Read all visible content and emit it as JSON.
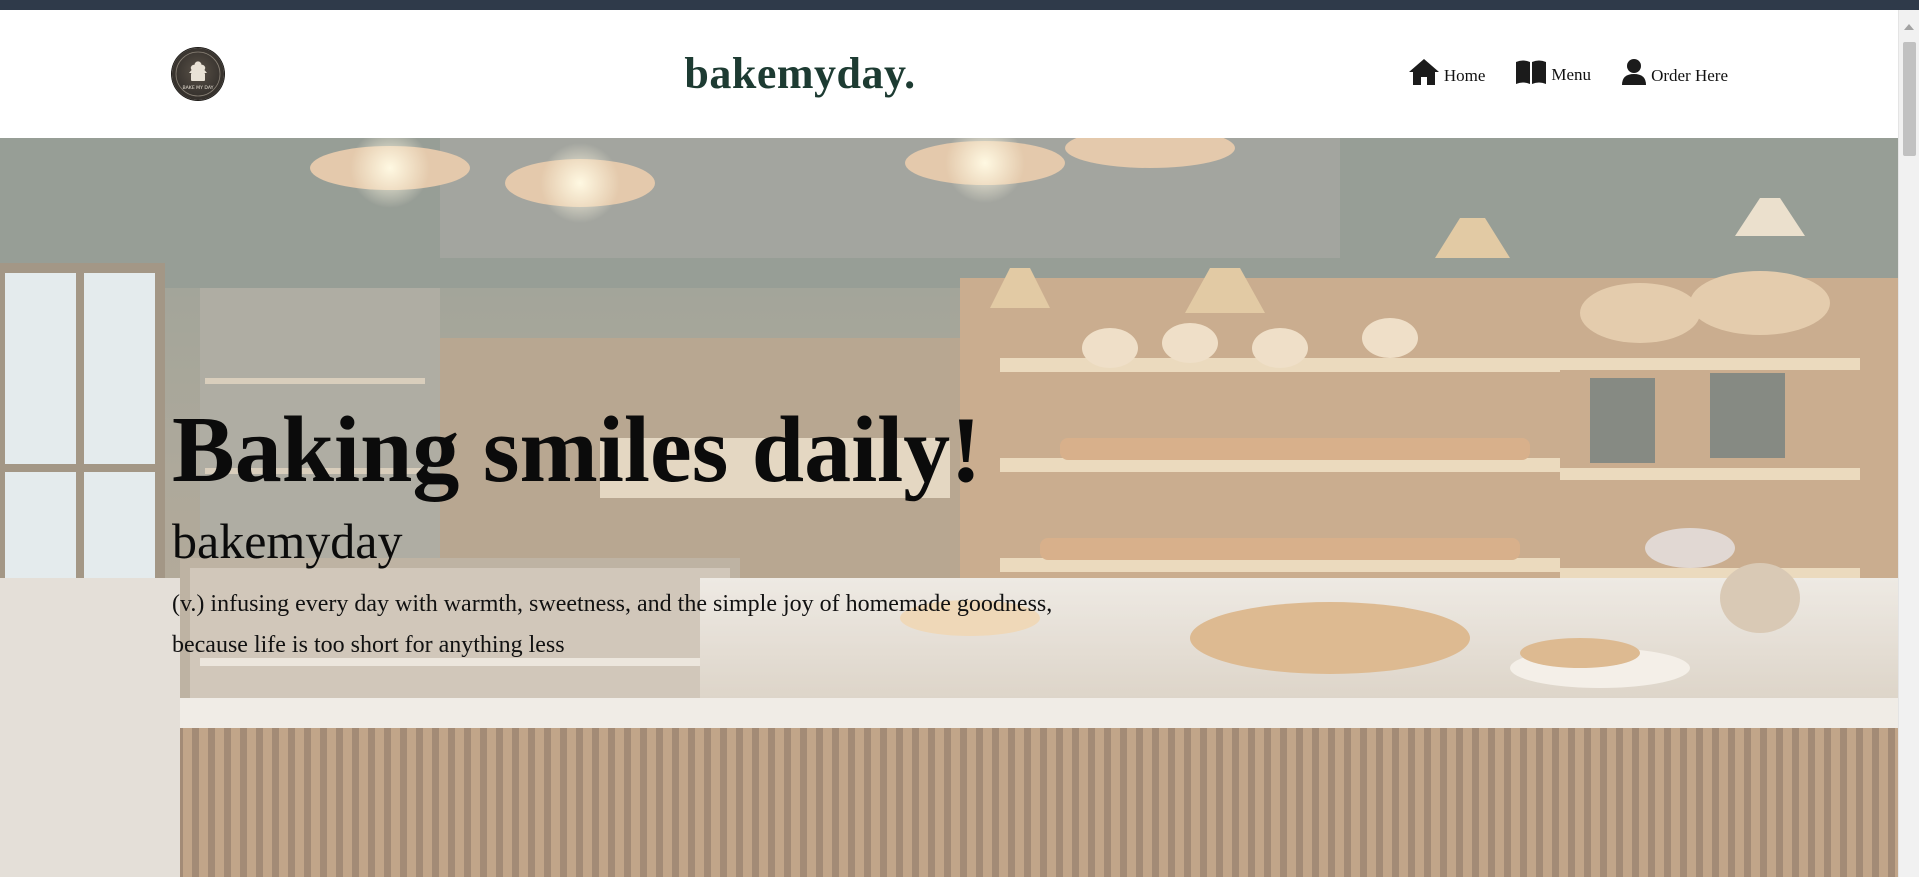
{
  "header": {
    "logo_icon": "bakery-logo-icon",
    "logo_text": "BAKE MY DAY",
    "brand": "bakemyday.",
    "nav": [
      {
        "label": "Home",
        "icon": "home-icon"
      },
      {
        "label": "Menu",
        "icon": "book-icon"
      },
      {
        "label": "Order Here",
        "icon": "user-icon"
      }
    ]
  },
  "hero": {
    "title": "Baking smiles daily!",
    "subtitle": "bakemyday",
    "description": "(v.) infusing every day with warmth, sweetness, and the simple joy of homemade goodness, because life is too short for anything less",
    "background": "bakery-interior-image"
  },
  "colors": {
    "brand": "#1d3b32",
    "top_strip": "#2f3a4a",
    "text": "#0b0b0b"
  }
}
